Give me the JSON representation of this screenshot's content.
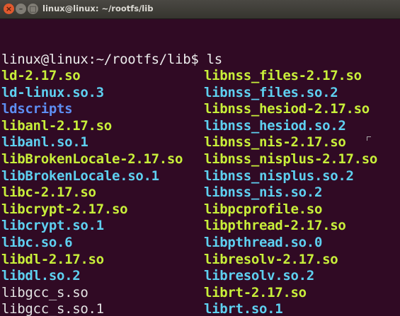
{
  "window": {
    "title": "linux@linux: ~/rootfs/lib",
    "close_glyph": "×",
    "minimize_glyph": "–",
    "maximize_glyph": "□"
  },
  "terminal": {
    "prompt": "linux@linux:~/rootfs/lib$ ls",
    "left_column": [
      {
        "name": "ld-2.17.so",
        "type": "exec"
      },
      {
        "name": "ld-linux.so.3",
        "type": "link"
      },
      {
        "name": "ldscripts",
        "type": "dir"
      },
      {
        "name": "libanl-2.17.so",
        "type": "exec"
      },
      {
        "name": "libanl.so.1",
        "type": "link"
      },
      {
        "name": "libBrokenLocale-2.17.so",
        "type": "exec"
      },
      {
        "name": "libBrokenLocale.so.1",
        "type": "link"
      },
      {
        "name": "libc-2.17.so",
        "type": "exec"
      },
      {
        "name": "libcrypt-2.17.so",
        "type": "exec"
      },
      {
        "name": "libcrypt.so.1",
        "type": "link"
      },
      {
        "name": "libc.so.6",
        "type": "link"
      },
      {
        "name": "libdl-2.17.so",
        "type": "exec"
      },
      {
        "name": "libdl.so.2",
        "type": "link"
      },
      {
        "name": "libgcc_s.so",
        "type": "plain"
      },
      {
        "name": "libgcc_s.so.1",
        "type": "plain"
      }
    ],
    "right_column": [
      {
        "name": "libnss_files-2.17.so",
        "type": "exec"
      },
      {
        "name": "libnss_files.so.2",
        "type": "link"
      },
      {
        "name": "libnss_hesiod-2.17.so",
        "type": "exec"
      },
      {
        "name": "libnss_hesiod.so.2",
        "type": "link"
      },
      {
        "name": "libnss_nis-2.17.so",
        "type": "exec"
      },
      {
        "name": "libnss_nisplus-2.17.so",
        "type": "exec"
      },
      {
        "name": "libnss_nisplus.so.2",
        "type": "link"
      },
      {
        "name": "libnss_nis.so.2",
        "type": "link"
      },
      {
        "name": "libpcprofile.so",
        "type": "exec"
      },
      {
        "name": "libpthread-2.17.so",
        "type": "exec"
      },
      {
        "name": "libpthread.so.0",
        "type": "link"
      },
      {
        "name": "libresolv-2.17.so",
        "type": "exec"
      },
      {
        "name": "libresolv.so.2",
        "type": "link"
      },
      {
        "name": "librt-2.17.so",
        "type": "exec"
      },
      {
        "name": "librt.so.1",
        "type": "link"
      }
    ]
  },
  "colors": {
    "background": "#300a24",
    "exec": "#c8ef3a",
    "link": "#5ed0f0",
    "dir": "#5d8ef2",
    "plain": "#e4e4e4"
  }
}
